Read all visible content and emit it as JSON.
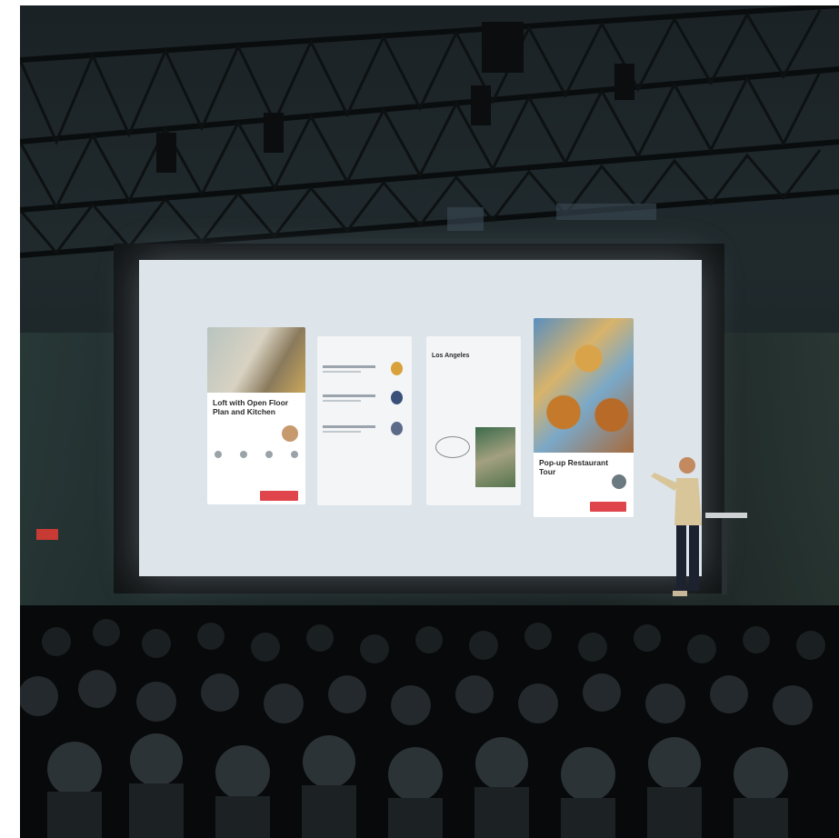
{
  "scene": {
    "description_tags": [
      "conference-stage",
      "presentation-screen",
      "presenter",
      "audience",
      "steel-truss-ceiling"
    ]
  },
  "screen_cards": {
    "card1": {
      "title": "Loft with Open Floor Plan and Kitchen"
    },
    "card3": {
      "title": "Los Angeles"
    },
    "card4": {
      "title": "Pop-up Restaurant Tour"
    }
  },
  "colors": {
    "accent_button": "#e0454b",
    "screen_bg": "#dde4ea",
    "room_dark": "#1b2226"
  }
}
